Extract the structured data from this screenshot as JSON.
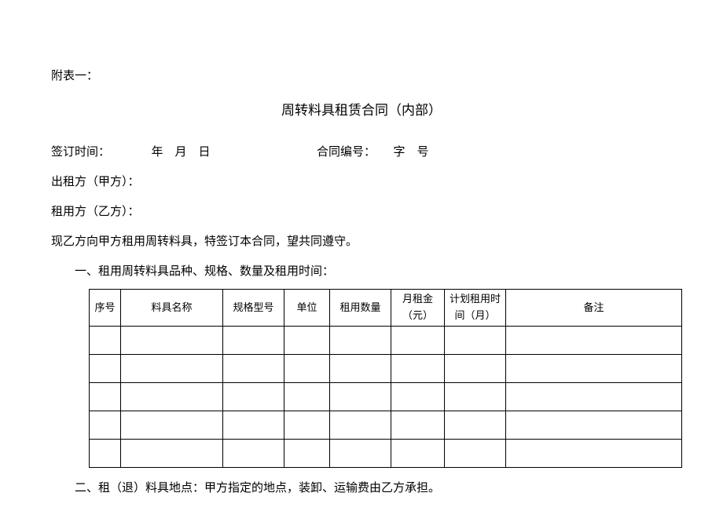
{
  "attachmentLabel": "附表一：",
  "title": "周转料具租赁合同（内部）",
  "signingTimeLabel": "签订时间：",
  "signingTimeValue": "年　月　日",
  "contractNoLabel": "合同编号：",
  "contractNoValue": "字　号",
  "partyALabel": "出租方（甲方）：",
  "partyBLabel": "租用方（乙方）：",
  "intro": "现乙方向甲方租用周转料具，特签订本合同，望共同遵守。",
  "sectionOne": "一、租用周转料具品种、规格、数量及租用时间：",
  "tableHeaders": {
    "seq": "序号",
    "name": "料具名称",
    "spec": "规格型号",
    "unit": "单位",
    "qty": "租用数量",
    "rent": "月租金（元）",
    "time": "计划租用时间（月）",
    "remark": "备注"
  },
  "sectionTwo": "二、租（退）料具地点：甲方指定的地点，装卸、运输费由乙方承担。"
}
